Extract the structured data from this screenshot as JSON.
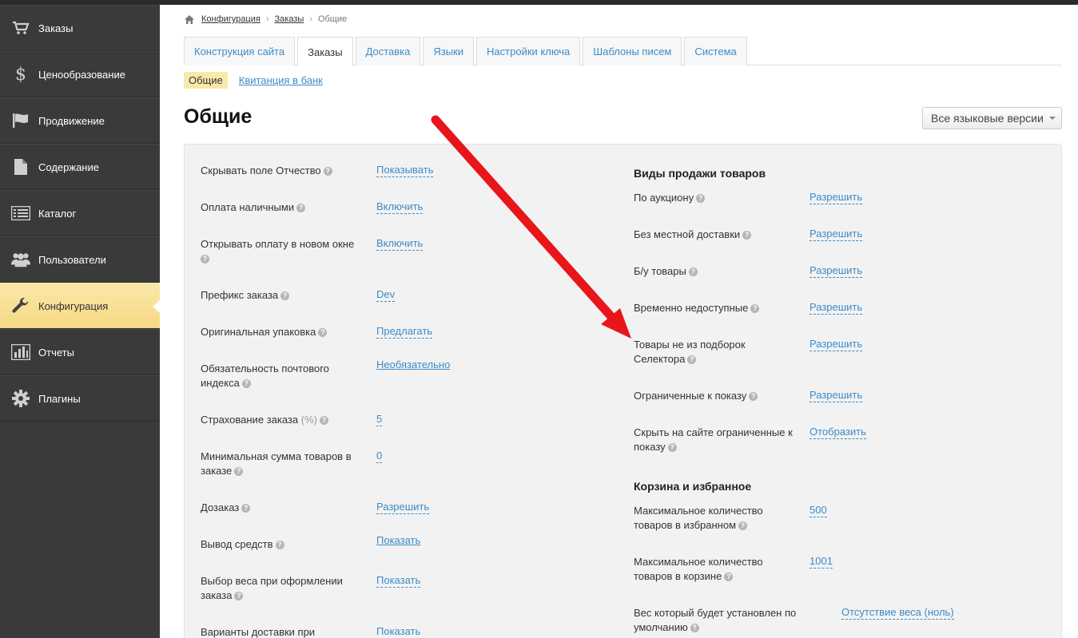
{
  "sidebar": {
    "items": [
      {
        "label": "Заказы",
        "icon": "cart-icon"
      },
      {
        "label": "Ценообразование",
        "icon": "dollar-icon"
      },
      {
        "label": "Продвижение",
        "icon": "flag-icon"
      },
      {
        "label": "Содержание",
        "icon": "document-icon"
      },
      {
        "label": "Каталог",
        "icon": "list-icon"
      },
      {
        "label": "Пользователи",
        "icon": "users-icon"
      },
      {
        "label": "Конфигурация",
        "icon": "wrench-icon",
        "active": true
      },
      {
        "label": "Отчеты",
        "icon": "bar-chart-icon"
      },
      {
        "label": "Плагины",
        "icon": "gear-icon"
      }
    ]
  },
  "breadcrumb": {
    "items": [
      "Конфигурация",
      "Заказы",
      "Общие"
    ],
    "separator": "›"
  },
  "tabs": [
    "Конструкция сайта",
    "Заказы",
    "Доставка",
    "Языки",
    "Настройки ключа",
    "Шаблоны писем",
    "Система"
  ],
  "subtabs": [
    "Общие",
    "Квитанция в банк"
  ],
  "page": {
    "title": "Общие",
    "lang_button": "Все языковые версии"
  },
  "left_settings": [
    {
      "label": "Скрывать поле Отчество",
      "value": "Показывать"
    },
    {
      "label": "Оплата наличными",
      "value": "Включить"
    },
    {
      "label_line1": "Открывать оплату в новом окне",
      "value": "Включить"
    },
    {
      "label": "Префикс заказа",
      "value": "Dev"
    },
    {
      "label": "Оригинальная упаковка",
      "value": "Предлагать"
    },
    {
      "label_line1": "Обязательность почтового",
      "label_line2": "индекса",
      "value": "Необязательно"
    },
    {
      "label": "Страхование заказа",
      "suffix": "(%)",
      "value": "5"
    },
    {
      "label_line1": "Минимальная сумма товаров в",
      "label_line2": "заказе",
      "value": "0"
    },
    {
      "label": "Дозаказ",
      "value": "Разрешить"
    },
    {
      "label": "Вывод средств",
      "value": "Показать"
    },
    {
      "label_line1": "Выбор веса при оформлении",
      "label_line2": "заказа",
      "value": "Показать"
    },
    {
      "label_line1": "Варианты доставки при",
      "value": "Показать"
    }
  ],
  "right_sections": {
    "sales_heading": "Виды продажи товаров",
    "sales": [
      {
        "label": "По аукциону",
        "value": "Разрешить"
      },
      {
        "label": "Без местной доставки",
        "value": "Разрешить"
      },
      {
        "label": "Б/у товары",
        "value": "Разрешить"
      },
      {
        "label": "Временно недоступные",
        "value": "Разрешить"
      },
      {
        "label_line1": "Товары не из подборок",
        "label_line2": "Селектора",
        "value": "Разрешить"
      },
      {
        "label": "Ограниченные к показу",
        "value": "Разрешить"
      },
      {
        "label_line1": "Скрыть на сайте ограниченные к",
        "label_line2": "показу",
        "value": "Отобразить"
      }
    ],
    "cart_heading": "Корзина и избранное",
    "cart": [
      {
        "label_line1": "Максимальное количество",
        "label_line2": "товаров в избранном",
        "value": "500"
      },
      {
        "label_line1": "Максимальное количество",
        "label_line2": "товаров в корзине",
        "value": "1001"
      },
      {
        "label_line1": "Вес который будет установлен по",
        "label_line2": "умолчанию",
        "value": "Отсутствие веса (ноль)"
      }
    ]
  },
  "help_glyph": "?",
  "annotation_color": "#e8161b"
}
